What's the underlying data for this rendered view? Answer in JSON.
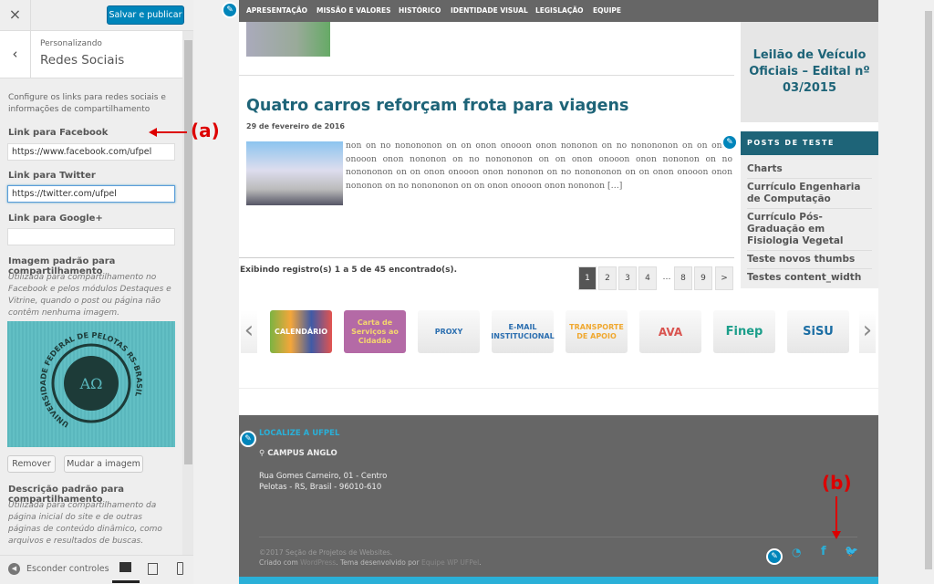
{
  "customizer": {
    "close_icon": "×",
    "save_label": "Salvar e publicar",
    "back_icon": "‹",
    "breadcrumb": "Personalizando",
    "section_title": "Redes Sociais",
    "intro": "Configure os links para redes sociais e informações de compartilhamento",
    "facebook_label": "Link para Facebook",
    "facebook_value": "https://www.facebook.com/ufpel",
    "twitter_label": "Link para Twitter",
    "twitter_value": "https://twitter.com/ufpel",
    "google_label": "Link para Google+",
    "google_value": "",
    "image_label": "Imagem padrão para compartilhamento",
    "image_desc": "Utilizada para compartilhamento no Facebook e pelos módulos Destaques e Vitrine, quando o post ou página não contêm nenhuma imagem.",
    "image_logo_text": "UNIVERSIDADE FEDERAL DE PELOTAS RS-BRASIL",
    "remove_label": "Remover",
    "change_label": "Mudar a imagem",
    "desc_label": "Descrição padrão para compartilhamento",
    "desc_desc": "Utilizada para compartilhamento da página inicial do site e de outras páginas de conteúdo dinâmico, como arquivos e resultados de buscas.",
    "hide_controls": "Esconder controles"
  },
  "site": {
    "nav": [
      "APRESENTAÇÃO",
      "MISSÃO E VALORES",
      "HISTÓRICO",
      "IDENTIDADE VISUAL",
      "LEGISLAÇÃO",
      "EQUIPE"
    ],
    "post_title": "Quatro carros reforçam frota para viagens",
    "post_date": "29 de fevereiro de 2016",
    "post_excerpt": "non on no nonononon on on onon onooon onon nononon on no nonononon on on onon onooon onon nononon on no nonononon on on onon onooon onon nononon on no nonononon on on onon onooon onon nononon on no nonononon on on onon onooon onon nononon on no nonononon on on onon onooon onon nononon […]",
    "showing": "Exibindo registro(s) 1 a 5 de 45 encontrado(s).",
    "pages": [
      "1",
      "2",
      "3",
      "4",
      "…",
      "8",
      "9",
      ">"
    ],
    "featured": "Leilão de Veículo Oficiais – Edital nº 03/2015",
    "widget_title": "POSTS DE TESTE",
    "widget_items": [
      "Charts",
      "Currículo Engenharia de Computação",
      "Currículo Pós-Graduação em Fisiologia Vegetal",
      "Teste novos thumbs",
      "Testes content_width"
    ],
    "carousel": [
      "CALENDÁRIO",
      "Carta de Serviços ao Cidadão",
      "PROXY",
      "E-MAIL INSTITUCIONAL",
      "TRANSPORTE DE APOIO",
      "AVA",
      "Finep",
      "SiSU"
    ],
    "footer": {
      "heading": "LOCALIZE A UFPEL",
      "campus": "CAMPUS ANGLO",
      "address1": "Rua Gomes Carneiro, 01 - Centro",
      "address2": "Pelotas - RS, Brasil - 96010-610",
      "copyright": "©2017 Seção de Projetos de Websites.",
      "credits_pre": "Criado com ",
      "credits_wp": "WordPress",
      "credits_mid": ". Tema desenvolvido por ",
      "credits_team": "Equipe WP UFPel",
      "credits_end": ".",
      "social": [
        "rss",
        "facebook",
        "twitter"
      ]
    }
  },
  "annotations": {
    "a": "(a)",
    "b": "(b)"
  },
  "colors": {
    "accent": "#0085ba",
    "brand": "#1e6478",
    "annotation": "#dd0000",
    "footer": "#666666",
    "strip": "#2ab0d8"
  }
}
